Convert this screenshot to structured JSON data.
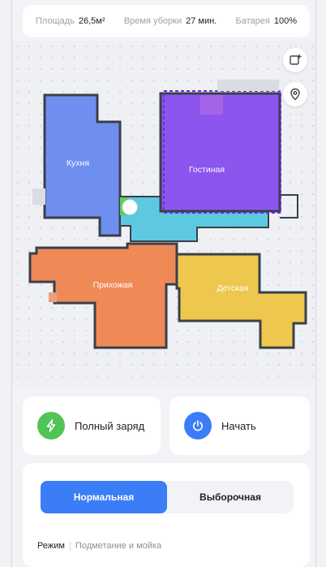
{
  "stats": {
    "area_label": "Площадь",
    "area_value": "26,5м²",
    "time_label": "Время уборки",
    "time_value": "27 мин.",
    "battery_label": "Батарея",
    "battery_value": "100%"
  },
  "map": {
    "rooms": {
      "kitchen": "Кухня",
      "living": "Гостиная",
      "hallway": "Прихожая",
      "kids": "Детская"
    },
    "colors": {
      "kitchen": "#6f8ff0",
      "living": "#8c55ee",
      "hallway": "#ef8a56",
      "kids": "#eec84e",
      "corridor": "#5dc9e0",
      "wall": "#3a3f4a"
    },
    "side_buttons": [
      "add-zone-icon",
      "location-pin-icon"
    ]
  },
  "actions": {
    "charge_label": "Полный заряд",
    "start_label": "Начать",
    "charge_color": "#52c455",
    "start_color": "#3b7df6"
  },
  "mode": {
    "tabs": [
      {
        "label": "Нормальная",
        "active": true
      },
      {
        "label": "Выборочная",
        "active": false
      }
    ],
    "mode_key": "Режим",
    "mode_value": "Подметание и мойка"
  }
}
